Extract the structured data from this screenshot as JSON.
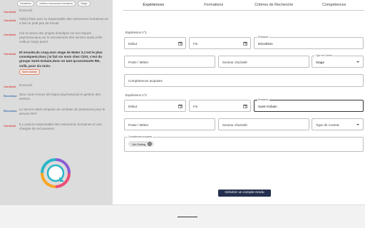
{
  "chat": {
    "chips": [
      "Décathlon",
      "métiers ressources humaines",
      "Stage"
    ],
    "messages": [
      {
        "who": "Candidat",
        "role": "cand",
        "text": "D'accord.",
        "bold": false,
        "tag": ""
      },
      {
        "who": "Candidat",
        "role": "cand",
        "text": "Voilà,j'étais avec la responsable des ressources humaines,on a fait un petit peu de travail.",
        "bold": false,
        "tag": ""
      },
      {
        "who": "Candidat",
        "role": "cand",
        "text": "mis en place des projets d'analyse sur les risques psychosociaux,sur le recrutement des seniors aussi,enfin voilà,un large panel.",
        "bold": false,
        "tag": ""
      },
      {
        "who": "Candidat",
        "role": "cand",
        "text": "Et ensuite,du coup,mon stage de Mater 2,c'est le plus conséquent,donc j'ai fait six mois chez CDO, c'est du groupe Saint-Gobain,donc en tant qu'assistante RH, voilà, pour six mois.",
        "bold": true,
        "tag": "Saint-Gobain"
      },
      {
        "who": "Candidat",
        "role": "cand",
        "text": "D'accord.",
        "bold": false,
        "tag": ""
      },
      {
        "who": "Recruteur",
        "role": "rec",
        "text": "donc vous m'avez dit risque psychosocial et gestion des seniors.",
        "bold": false,
        "tag": ""
      },
      {
        "who": "Recruteur",
        "role": "rec",
        "text": "Le service était composé de combien de personnes pour le service RH?",
        "bold": false,
        "tag": ""
      },
      {
        "who": "Candidat",
        "role": "cand",
        "text": "Il y avait la responsable des ressources humaines et une chargée de recrutement.",
        "bold": false,
        "tag": ""
      }
    ]
  },
  "tabs": [
    "Expériences",
    "Formations",
    "Critères de Recherche",
    "Compétences"
  ],
  "experiences": [
    {
      "title": "Expérience n°1",
      "debut_placeholder": "Début",
      "fin_placeholder": "Fin",
      "entreprise_legend": "Entreprise",
      "entreprise_value": "Décathlon",
      "poste_placeholder": "Poste / Métier",
      "secteur_placeholder": "Secteur d'activité",
      "contrat_legend": "Type de Contrat",
      "contrat_value": "Stage",
      "competences_placeholder": "Compétences acquises"
    },
    {
      "title": "Expérience n°2",
      "debut_placeholder": "Début",
      "fin_placeholder": "Fin",
      "entreprise_legend": "Entreprise",
      "entreprise_value": "Saint-Gobain",
      "poste_placeholder": "Poste / Métier",
      "secteur_placeholder": "Secteur d'activité",
      "contrat_placeholder": "Type de Contrat",
      "competences_legend": "Compétences acquises",
      "competences_chip": "Job Dating"
    }
  ],
  "generate_button": "Générer un compte-rendu",
  "colors": {
    "candidat": "#d9534f",
    "recruteur": "#3a6fb0",
    "button": "#25304f",
    "panel": "#dcdcdc"
  }
}
